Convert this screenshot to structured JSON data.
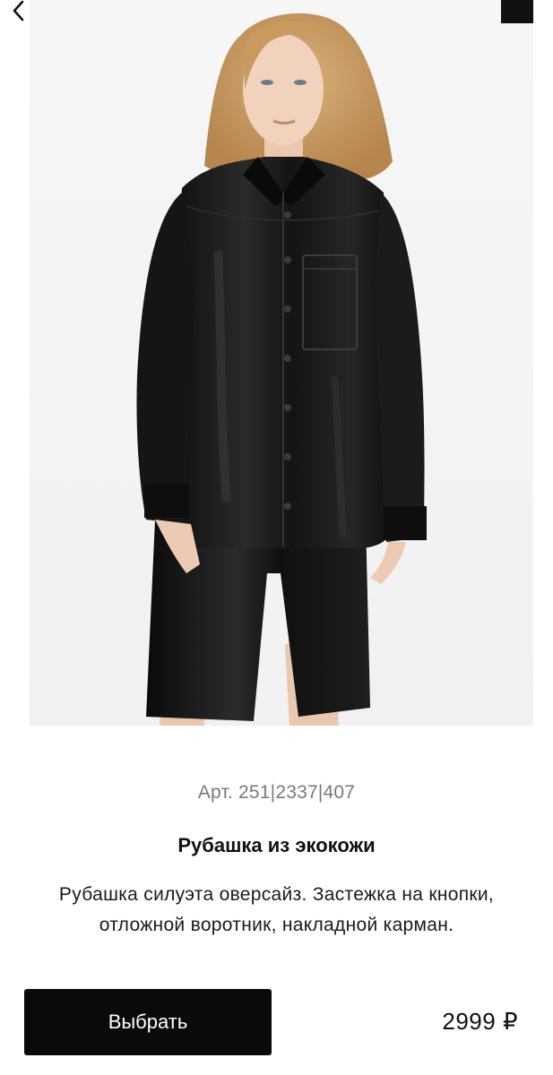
{
  "header": {
    "back_icon": "chevron-left-icon",
    "menu_icon": "black-square-icon"
  },
  "product": {
    "image_icon": "product-photo",
    "article": "Арт. 251|2337|407",
    "title": "Рубашка из экокожи",
    "description": "Рубашка силуэта оверсайз. Застежка на кнопки, отложной воротник, накладной карман.",
    "price": "2999 ₽"
  },
  "actions": {
    "select_label": "Выбрать"
  },
  "colors": {
    "button_bg": "#0a0a0a",
    "button_text": "#ffffff",
    "article_text": "#7a7a7a",
    "photo_bg": "#f3f3f3"
  }
}
